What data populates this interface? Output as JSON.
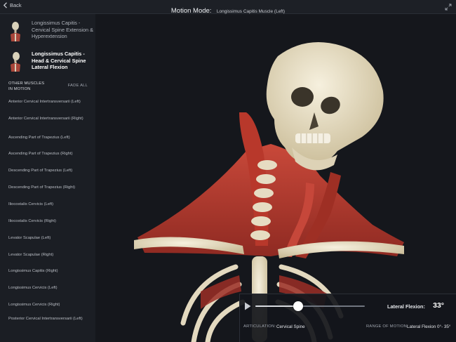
{
  "topbar": {
    "back_label": "Back",
    "title": "Motion Mode:",
    "subtitle": "Longissimus Capitis Muscle (Left)"
  },
  "motions": [
    {
      "label": "Longissimus Capitis - Cervical Spine Extension & Hyperextension",
      "active": false
    },
    {
      "label": "Longissimus Capitis - Head & Cervical Spine Lateral Flexion",
      "active": true
    }
  ],
  "other_muscles": {
    "heading_line1": "OTHER MUSCLES",
    "heading_line2": "IN MOTION",
    "fade_all_label": "FADE ALL",
    "items": [
      "Anterior Cervical Intertransversarii (Left)",
      "Anterior Cervical Intertransversarii (Right)",
      "Ascending Part of Trapezius (Left)",
      "Ascending Part of Trapezius (Right)",
      "Descending Part of Trapezius (Left)",
      "Descending Part of Trapezius (Right)",
      "Iliocostalis Cervicis (Left)",
      "Iliocostalis Cervicis (Right)",
      "Levator Scapulae (Left)",
      "Levator Scapulae (Right)",
      "Longissimus Capitis (Right)",
      "Longissimus Cervicis (Left)",
      "Longissimus Cervicis (Right)",
      "Posterior Cervical Intertransversarii (Left)"
    ]
  },
  "control": {
    "motion_label": "Lateral Flexion:",
    "motion_value": "33°",
    "slider_fraction": 0.39,
    "articulation_label": "ARTICULATION:",
    "articulation_value": "Cervical Spine",
    "range_label": "RANGE OF MOTION:",
    "range_value": "Lateral Flexion 0°- 35°"
  },
  "colors": {
    "sidebar_bg": "#1b1e24",
    "viewer_bg": "#15171c",
    "bone": "#e8e0c8",
    "muscle": "#b33a2c"
  },
  "icons": {
    "back": "chevron-left-icon",
    "expand": "expand-icon",
    "play": "play-icon"
  }
}
